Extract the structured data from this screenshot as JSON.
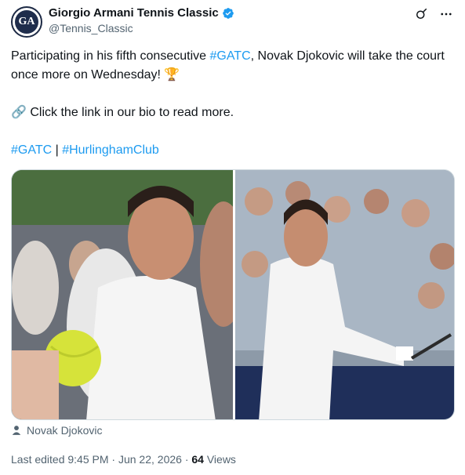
{
  "account": {
    "name": "Giorgio Armani Tennis Classic",
    "handle": "@Tennis_Classic",
    "avatar_letters": "GA"
  },
  "tweet": {
    "line1_pre": "Participating in his fifth consecutive ",
    "line1_hashtag": "#GATC",
    "line1_post": ", Novak Djokovic will take the court once more on Wednesday! 🏆",
    "line2": "🔗 Click the link in our bio to read more.",
    "hashtag1": "#GATC",
    "separator": " | ",
    "hashtag2": "#HurlinghamClub"
  },
  "media": {
    "tagged_person": "Novak Djokovic"
  },
  "meta": {
    "edited": "Last edited 9:45 PM · Jun 22, 2026 · ",
    "views_count": "64",
    "views_label": " Views"
  },
  "colors": {
    "link": "#1d9bf0",
    "secondary_text": "#536471",
    "verified": "#1d9bf0"
  },
  "icons": [
    "verified-badge-icon",
    "grok-icon",
    "more-options-icon",
    "person-tag-icon",
    "trophy-emoji",
    "link-emoji"
  ]
}
